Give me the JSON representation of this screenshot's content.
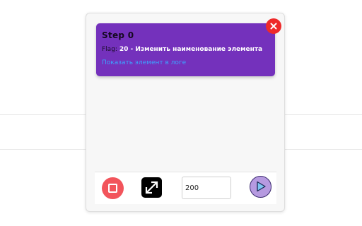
{
  "step_card": {
    "title": "Step 0",
    "flag_label": "Flag:",
    "flag_value": "20 - Изменить наименование элемента",
    "show_link": "Показать элемент в логе",
    "close_icon": "close-icon"
  },
  "toolbar": {
    "stop_icon": "stop-icon",
    "expand_icon": "expand-icon",
    "delay_value": "200",
    "play_icon": "play-icon"
  },
  "colors": {
    "card_bg": "#7431bc",
    "close_bg": "#ee2a2a",
    "stop_bg": "#f2545b",
    "play_bg": "#b69ae0",
    "link": "#3da2ff"
  }
}
